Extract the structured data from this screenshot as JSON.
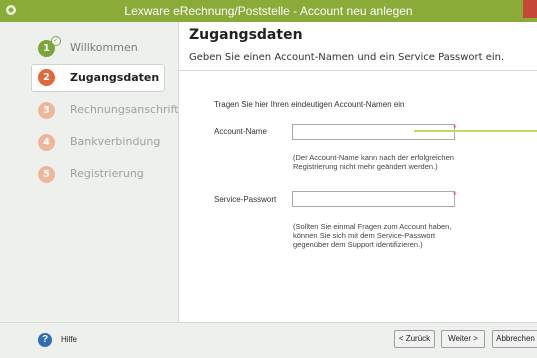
{
  "window": {
    "title": "Lexware eRechnung/Poststelle - Account neu anlegen"
  },
  "sidebar": {
    "steps": [
      {
        "number": "1",
        "label": "Willkommen",
        "state": "done"
      },
      {
        "number": "2",
        "label": "Zugangsdaten",
        "state": "active"
      },
      {
        "number": "3",
        "label": "Rechnungsanschrift",
        "state": "todo"
      },
      {
        "number": "4",
        "label": "Bankverbindung",
        "state": "todo"
      },
      {
        "number": "5",
        "label": "Registrierung",
        "state": "todo"
      }
    ]
  },
  "header": {
    "title": "Zugangsdaten",
    "subtitle": "Geben Sie einen Account-Namen und ein Service Passwort ein."
  },
  "form": {
    "intro": "Tragen Sie hier Ihren eindeutigen Account-Namen ein",
    "account_name_label": "Account-Name",
    "account_name_value": "",
    "account_name_hint_1": "(Der Account-Name kann nach der erfolgreichen",
    "account_name_hint_2": "Registrierung nicht mehr geändert werden.)",
    "password_label": "Service-Passwort",
    "password_value": "",
    "password_hint_1": "(Sollten Sie einmal Fragen zum Account haben,",
    "password_hint_2": "können Sie sich mit dem Service-Passwort",
    "password_hint_3": "gegenüber dem Support identifizieren.)",
    "required_marker": "*"
  },
  "footer": {
    "help_label": "Hilfe",
    "back_label": "< Zurück",
    "next_label": "Weiter >",
    "cancel_label": "Abbrechen"
  },
  "colors": {
    "titlebar": "#8aab37",
    "active_step": "#e2683a",
    "done_step": "#7aa63a",
    "todo_step": "#f0b69c",
    "required": "#dd4433"
  }
}
